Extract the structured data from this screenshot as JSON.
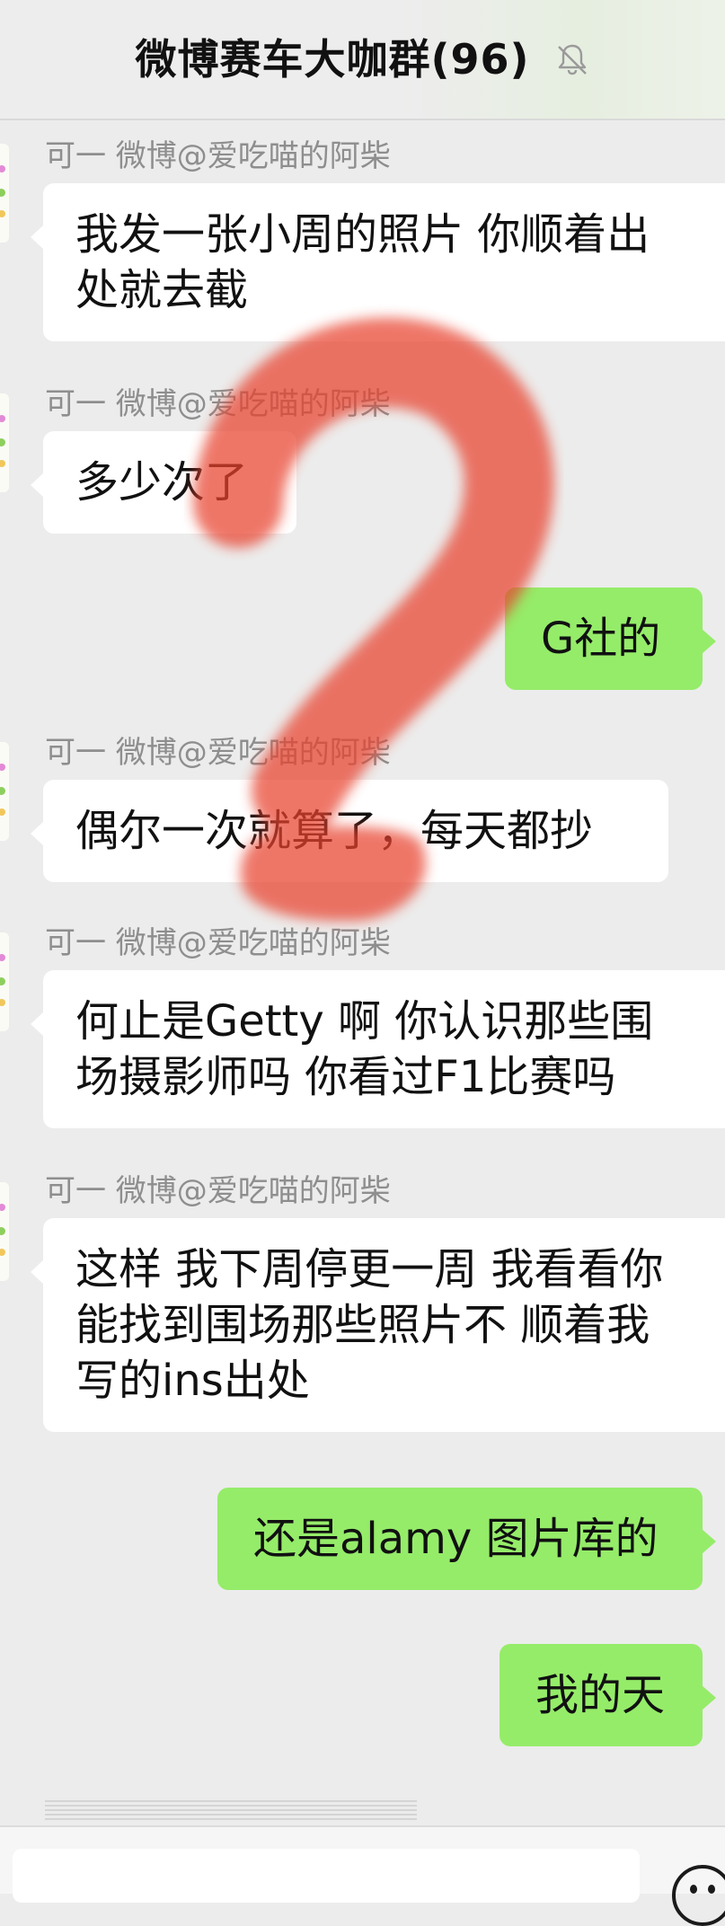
{
  "header": {
    "title": "微博赛车大咖群(96)",
    "mute_icon": "bell-slash-icon"
  },
  "messages": [
    {
      "direction": "in",
      "sender": "可一 微博@爱吃喵的阿柴",
      "lines": [
        "我发一张小周的照片 你顺着出",
        "处就去截"
      ]
    },
    {
      "direction": "in",
      "sender": "可一 微博@爱吃喵的阿柴",
      "lines": [
        "多少次了"
      ]
    },
    {
      "direction": "out",
      "lines": [
        "G社的"
      ]
    },
    {
      "direction": "in",
      "sender": "可一 微博@爱吃喵的阿柴",
      "lines": [
        "偶尔一次就算了，每天都抄"
      ]
    },
    {
      "direction": "in",
      "sender": "可一 微博@爱吃喵的阿柴",
      "lines": [
        "何止是Getty 啊  你认识那些围",
        "场摄影师吗 你看过F1比赛吗"
      ]
    },
    {
      "direction": "in",
      "sender": "可一 微博@爱吃喵的阿柴",
      "lines": [
        "这样 我下周停更一周 我看看你",
        "能找到围场那些照片不 顺着我",
        "写的ins出处"
      ]
    },
    {
      "direction": "out",
      "lines": [
        "还是alamy 图片库的"
      ]
    },
    {
      "direction": "out",
      "lines": [
        "我的天"
      ]
    }
  ],
  "annotation": {
    "type": "question-mark-scribble",
    "color": "#e8432f"
  },
  "input_bar": {
    "emoji_icon": "emoji-smiley-icon"
  },
  "colors": {
    "outgoing_bubble": "#95ec69",
    "incoming_bubble": "#ffffff",
    "background": "#ececec"
  }
}
